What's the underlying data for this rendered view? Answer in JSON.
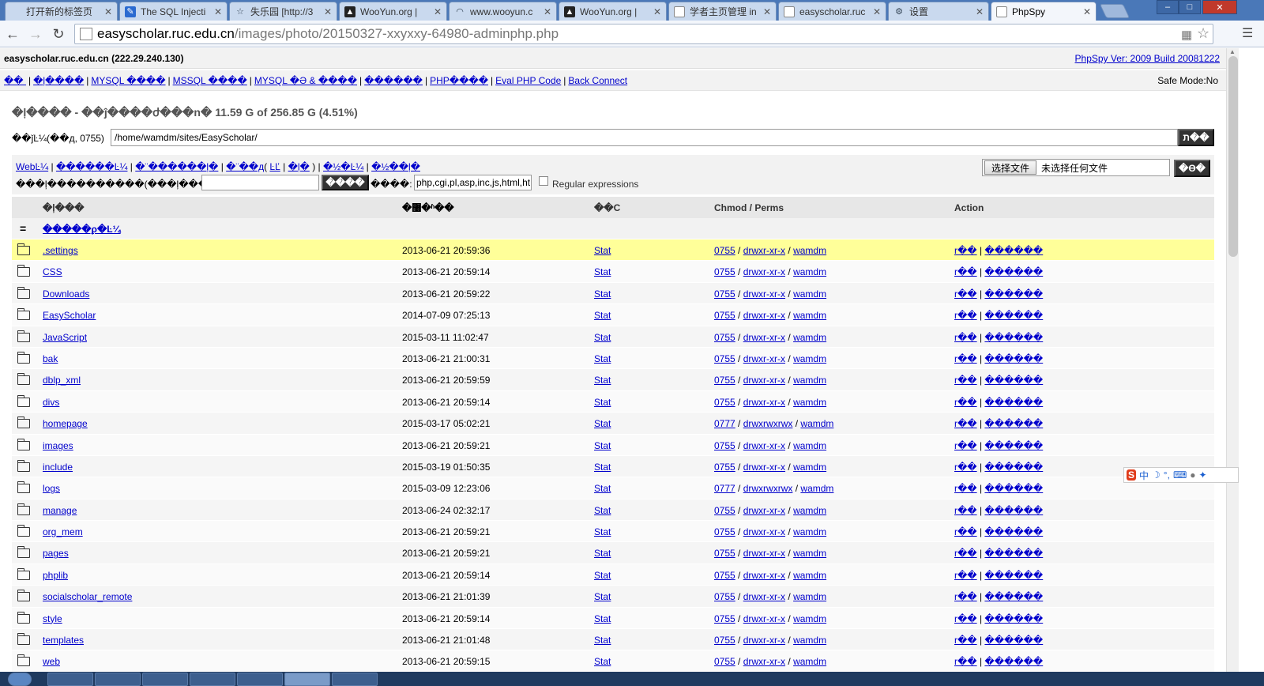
{
  "browser": {
    "tabs": [
      {
        "title": "打开新的标签页",
        "icon": "blank-page-icon",
        "active": false
      },
      {
        "title": "The SQL Injecti",
        "icon": "edit-icon",
        "active": false
      },
      {
        "title": "失乐园 [http://3",
        "icon": "star-icon",
        "active": false
      },
      {
        "title": "WooYun.org | ",
        "icon": "wooyun-icon",
        "active": false
      },
      {
        "title": "www.wooyun.c",
        "icon": "loading-icon",
        "active": false
      },
      {
        "title": "WooYun.org | ",
        "icon": "wooyun-icon",
        "active": false
      },
      {
        "title": "学者主页管理 in",
        "icon": "page-icon",
        "active": false
      },
      {
        "title": "easyscholar.ruc",
        "icon": "page-icon",
        "active": false
      },
      {
        "title": "设置",
        "icon": "gear-icon",
        "active": false
      },
      {
        "title": "PhpSpy",
        "icon": "page-icon",
        "active": true
      }
    ],
    "url_host": "easyscholar.ruc.edu.cn",
    "url_path": "/images/photo/20150327-xxyxxy-64980-adminphp.php"
  },
  "header": {
    "host": "easyscholar.ruc.edu.cn (222.29.240.130)",
    "version": "PhpSpy Ver: 2009 Build 20081222",
    "nav_links": [
      "�� ",
      "�ļ����",
      "MYSQL ����",
      "MSSQL ����",
      "MYSQL �Ә & ����",
      "������",
      "PHP����",
      "Eval PHP Code",
      "Back Connect"
    ],
    "safe_mode": "Safe Mode:No"
  },
  "disk_info": "�ļ���� - ��ĵ����ժ���n� 11.59 G of 256.85 G (4.51%)",
  "path": {
    "label": "��ǰĿ¼(��д, 0755)",
    "value": "/home/wamdm/sites/EasyScholar/",
    "go_label": "ת��"
  },
  "tools": {
    "links": [
      "WebĿ¼",
      "������Ŀ¼",
      "�¨������ļ�",
      "�¨��д",
      "ĿĽ",
      "�ļ�",
      "�½�Ŀ¼",
      "�½��ļ�"
    ],
    "search_label": "���ļ����������(���ļ�����):",
    "search_button": "����",
    "ext_label": "����:",
    "ext_value": "php,cgi,pl,asp,inc,js,html,ht",
    "regex_label": "Regular expressions",
    "file_button": "选择文件",
    "file_none": "未选择任何文件",
    "upload_label": "�ϴ�"
  },
  "table": {
    "headers": {
      "name": "�ļ���",
      "time": "�޸�ʱ��",
      "size": "��С",
      "perms": "Chmod / Perms",
      "action": "Action"
    },
    "parent_dir": "=",
    "parent_label": "�����ϼ�Ŀ¼",
    "rows": [
      {
        "name": ".settings",
        "time": "2013-06-21 20:59:36",
        "stat": "Stat",
        "chmod": "0755",
        "perms": "drwxr-xr-x",
        "owner": "wamdm",
        "act1": "r��",
        "act2": "������"
      },
      {
        "name": "CSS",
        "time": "2013-06-21 20:59:14",
        "stat": "Stat",
        "chmod": "0755",
        "perms": "drwxr-xr-x",
        "owner": "wamdm",
        "act1": "r��",
        "act2": "������"
      },
      {
        "name": "Downloads",
        "time": "2013-06-21 20:59:22",
        "stat": "Stat",
        "chmod": "0755",
        "perms": "drwxr-xr-x",
        "owner": "wamdm",
        "act1": "r��",
        "act2": "������"
      },
      {
        "name": "EasyScholar",
        "time": "2014-07-09 07:25:13",
        "stat": "Stat",
        "chmod": "0755",
        "perms": "drwxr-xr-x",
        "owner": "wamdm",
        "act1": "r��",
        "act2": "������"
      },
      {
        "name": "JavaScript",
        "time": "2015-03-11 11:02:47",
        "stat": "Stat",
        "chmod": "0755",
        "perms": "drwxr-xr-x",
        "owner": "wamdm",
        "act1": "r��",
        "act2": "������"
      },
      {
        "name": "bak",
        "time": "2013-06-21 21:00:31",
        "stat": "Stat",
        "chmod": "0755",
        "perms": "drwxr-xr-x",
        "owner": "wamdm",
        "act1": "r��",
        "act2": "������"
      },
      {
        "name": "dblp_xml",
        "time": "2013-06-21 20:59:59",
        "stat": "Stat",
        "chmod": "0755",
        "perms": "drwxr-xr-x",
        "owner": "wamdm",
        "act1": "r��",
        "act2": "������"
      },
      {
        "name": "divs",
        "time": "2013-06-21 20:59:14",
        "stat": "Stat",
        "chmod": "0755",
        "perms": "drwxr-xr-x",
        "owner": "wamdm",
        "act1": "r��",
        "act2": "������"
      },
      {
        "name": "homepage",
        "time": "2015-03-17 05:02:21",
        "stat": "Stat",
        "chmod": "0777",
        "perms": "drwxrwxrwx",
        "owner": "wamdm",
        "act1": "r��",
        "act2": "������"
      },
      {
        "name": "images",
        "time": "2013-06-21 20:59:21",
        "stat": "Stat",
        "chmod": "0755",
        "perms": "drwxr-xr-x",
        "owner": "wamdm",
        "act1": "r��",
        "act2": "������"
      },
      {
        "name": "include",
        "time": "2015-03-19 01:50:35",
        "stat": "Stat",
        "chmod": "0755",
        "perms": "drwxr-xr-x",
        "owner": "wamdm",
        "act1": "r��",
        "act2": "������"
      },
      {
        "name": "logs",
        "time": "2015-03-09 12:23:06",
        "stat": "Stat",
        "chmod": "0777",
        "perms": "drwxrwxrwx",
        "owner": "wamdm",
        "act1": "r��",
        "act2": "������"
      },
      {
        "name": "manage",
        "time": "2013-06-24 02:32:17",
        "stat": "Stat",
        "chmod": "0755",
        "perms": "drwxr-xr-x",
        "owner": "wamdm",
        "act1": "r��",
        "act2": "������"
      },
      {
        "name": "org_mem",
        "time": "2013-06-21 20:59:21",
        "stat": "Stat",
        "chmod": "0755",
        "perms": "drwxr-xr-x",
        "owner": "wamdm",
        "act1": "r��",
        "act2": "������"
      },
      {
        "name": "pages",
        "time": "2013-06-21 20:59:21",
        "stat": "Stat",
        "chmod": "0755",
        "perms": "drwxr-xr-x",
        "owner": "wamdm",
        "act1": "r��",
        "act2": "������"
      },
      {
        "name": "phplib",
        "time": "2013-06-21 20:59:14",
        "stat": "Stat",
        "chmod": "0755",
        "perms": "drwxr-xr-x",
        "owner": "wamdm",
        "act1": "r��",
        "act2": "������"
      },
      {
        "name": "socialscholar_remote",
        "time": "2013-06-21 21:01:39",
        "stat": "Stat",
        "chmod": "0755",
        "perms": "drwxr-xr-x",
        "owner": "wamdm",
        "act1": "r��",
        "act2": "������"
      },
      {
        "name": "style",
        "time": "2013-06-21 20:59:14",
        "stat": "Stat",
        "chmod": "0755",
        "perms": "drwxr-xr-x",
        "owner": "wamdm",
        "act1": "r��",
        "act2": "������"
      },
      {
        "name": "templates",
        "time": "2013-06-21 21:01:48",
        "stat": "Stat",
        "chmod": "0755",
        "perms": "drwxr-xr-x",
        "owner": "wamdm",
        "act1": "r��",
        "act2": "������"
      },
      {
        "name": "web",
        "time": "2013-06-21 20:59:15",
        "stat": "Stat",
        "chmod": "0755",
        "perms": "drwxr-xr-x",
        "owner": "wamdm",
        "act1": "r��",
        "act2": "������"
      }
    ]
  },
  "ime": {
    "mode": "中",
    "icons": [
      "sogou-logo-icon",
      "moon-icon",
      "punctuation-icon",
      "keyboard-icon",
      "user-icon",
      "wrench-icon"
    ]
  },
  "colors": {
    "link": "#0000cc",
    "highlight_row": "#ffff99",
    "tabstrip": "#4a78b8"
  }
}
